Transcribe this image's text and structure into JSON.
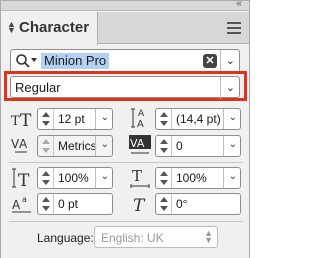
{
  "panel": {
    "tab_title": "Character",
    "collapse_glyph": "‹‹"
  },
  "font": {
    "family": "Minion Pro",
    "clear_glyph": "✕",
    "style": "Regular"
  },
  "fields": {
    "size": "12 pt",
    "leading": "(14,4 pt)",
    "kerning": "Metrics",
    "tracking": "0",
    "vertical_scale": "100%",
    "horizontal_scale": "100%",
    "baseline_shift": "0 pt",
    "skew": "0°"
  },
  "language": {
    "label": "Language:",
    "value": "English: UK"
  },
  "icons": {
    "search": "search-icon",
    "clear": "clear-icon",
    "menu": "panel-menu-icon",
    "font_size": "font-size-icon",
    "leading": "leading-icon",
    "kerning": "kerning-icon",
    "tracking": "tracking-icon",
    "vertical_scale": "vertical-scale-icon",
    "horizontal_scale": "horizontal-scale-icon",
    "baseline_shift": "baseline-shift-icon",
    "skew": "skew-icon"
  },
  "colors": {
    "highlight": "#e0321c",
    "selection": "#b3d1f3",
    "panel_bg": "#f0f0f0"
  }
}
